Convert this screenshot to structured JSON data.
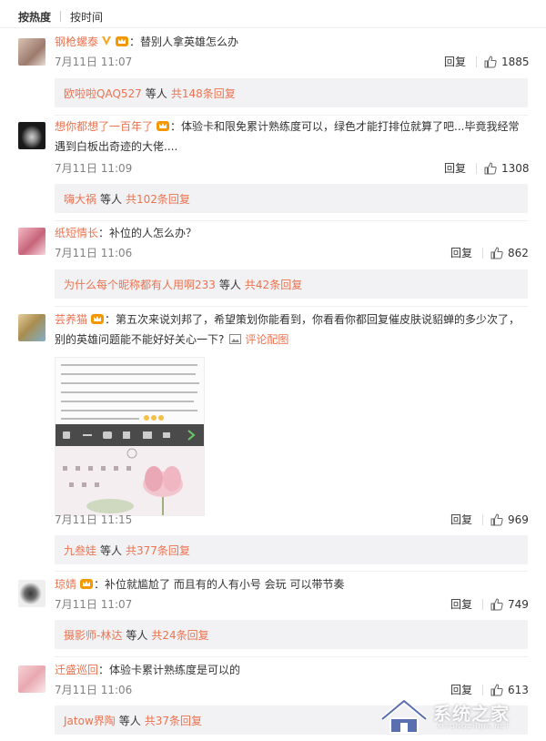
{
  "tabs": [
    {
      "label": "按热度",
      "active": true
    },
    {
      "label": "按时间",
      "active": false
    }
  ],
  "reply_label": "回复",
  "comments": [
    {
      "username": "钢枪螺泰",
      "text": "：替别人拿英雄怎么办",
      "time": "7月11日 11:07",
      "likes": "1885",
      "sub_names": "欧啦啦QAQ527",
      "sub_mid": "等人",
      "sub_count": "共148条回复"
    },
    {
      "username": "想你都想了一百年了",
      "text": "：体验卡和限免累计熟练度可以，绿色才能打排位就算了吧...毕竟我经常遇到白板出奇迹的大佬....",
      "time": "7月11日 11:09",
      "likes": "1308",
      "sub_names": "嗨大祸",
      "sub_mid": "等人",
      "sub_count": "共102条回复"
    },
    {
      "username": "纸短情长",
      "text": "：补位的人怎么办？",
      "time": "7月11日 11:06",
      "likes": "862",
      "sub_names": "为什么每个昵称都有人用啊233",
      "sub_mid": "等人",
      "sub_count": "共42条回复"
    },
    {
      "username": "芸养猫",
      "text": "：第五次来说刘邦了，希望策划你能看到，你看看你都回复催皮肤说貂蝉的多少次了，别的英雄问题能不能好好关心一下?",
      "pic_link": "评论配图",
      "time": "7月11日 11:15",
      "likes": "969",
      "sub_names": "九叁娃",
      "sub_mid": "等人",
      "sub_count": "共377条回复"
    },
    {
      "username": "琼婧",
      "text": "：补位就尴尬了 而且有的人有小号 会玩 可以带节奏",
      "time": "7月11日 11:07",
      "likes": "749",
      "sub_names": "摄影师-林达",
      "sub_mid": "等人",
      "sub_count": "共24条回复"
    },
    {
      "username": "迁盛巡回",
      "text": "：体验卡累计熟练度是可以的",
      "time": "7月11日 11:06",
      "likes": "613",
      "sub_names": "Jatow界陶",
      "sub_mid": "等人",
      "sub_count": "共37条回复"
    }
  ],
  "watermark": {
    "title": "系统之家",
    "subtitle": "XITONGZHIJIA.NET"
  },
  "colors": {
    "accent": "#eb7350",
    "sub_bg": "#f2f2f5",
    "meta": "#808080"
  }
}
